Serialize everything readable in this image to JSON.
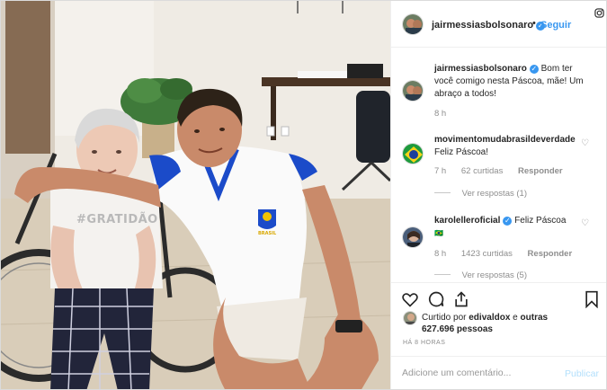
{
  "post": {
    "username": "jairmessiasbolsonaro",
    "follow_label": "Seguir",
    "dot": "•",
    "caption": "Bom ter você comigo nesta Páscoa, mãe! Um abraço a todos!",
    "caption_time": "8 h",
    "photo_shirt_text": "#GRATIDÃO",
    "photo_badge_text": "BRASIL"
  },
  "comments": [
    {
      "username": "movimentomudabrasildeverdade",
      "text": "Feliz Páscoa!",
      "time": "7 h",
      "likes": "62 curtidas",
      "reply_label": "Responder",
      "view_replies": "Ver respostas (1)"
    },
    {
      "username": "karolelleroficial",
      "text": "Feliz Páscoa",
      "line2": "🇧🇷",
      "time": "8 h",
      "likes": "1423 curtidas",
      "reply_label": "Responder",
      "view_replies": "Ver respostas (5)"
    }
  ],
  "likes": {
    "prefix": "Curtido por",
    "user": "edivaldox",
    "connector": "e",
    "others": "outras 627.696 pessoas"
  },
  "post_time": "HÁ 8 HORAS",
  "comment_box": {
    "placeholder": "Adicione um comentário...",
    "publish_label": "Publicar"
  },
  "colors": {
    "accent": "#3897f0",
    "publish_disabled": "#b2dffc",
    "muted": "#8e8e8e"
  },
  "icons": [
    "heart-icon",
    "comment-icon",
    "share-icon",
    "bookmark-icon",
    "verified-icon",
    "instagram-icon"
  ]
}
